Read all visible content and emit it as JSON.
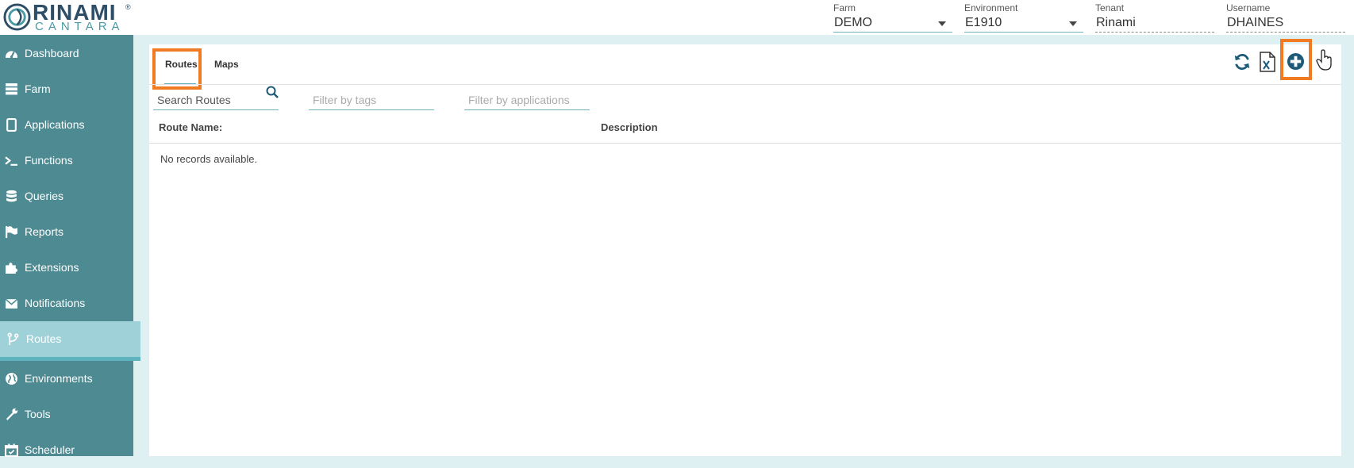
{
  "brand": {
    "name": "RINAMI",
    "sub": "CANTARA",
    "reg": "®"
  },
  "header": {
    "farm": {
      "label": "Farm",
      "value": "DEMO"
    },
    "environment": {
      "label": "Environment",
      "value": "E1910"
    },
    "tenant": {
      "label": "Tenant",
      "value": "Rinami"
    },
    "username": {
      "label": "Username",
      "value": "DHAINES"
    }
  },
  "sidebar": {
    "items": [
      {
        "label": "Dashboard",
        "icon": "dashboard-icon"
      },
      {
        "label": "Farm",
        "icon": "server-icon"
      },
      {
        "label": "Applications",
        "icon": "tablet-icon"
      },
      {
        "label": "Functions",
        "icon": "terminal-icon"
      },
      {
        "label": "Queries",
        "icon": "database-icon"
      },
      {
        "label": "Reports",
        "icon": "flag-icon"
      },
      {
        "label": "Extensions",
        "icon": "puzzle-icon"
      },
      {
        "label": "Notifications",
        "icon": "envelope-icon"
      },
      {
        "label": "Routes",
        "icon": "code-branch-icon",
        "active": true
      },
      {
        "label": "Environments",
        "icon": "globe-icon"
      },
      {
        "label": "Tools",
        "icon": "wrench-icon"
      },
      {
        "label": "Scheduler",
        "icon": "calendar-icon"
      }
    ]
  },
  "tabs": {
    "routes": "Routes",
    "maps": "Maps"
  },
  "toolbar": {
    "refresh": "refresh-icon",
    "excel": "excel-export-icon",
    "add": "add-circle-icon",
    "cursor": "hand-pointer-icon"
  },
  "filters": {
    "search": "Search Routes",
    "tags_placeholder": "Filter by tags",
    "apps_placeholder": "Filter by applications"
  },
  "table": {
    "columns": [
      "Route Name:",
      "Description"
    ],
    "empty": "No records available."
  },
  "colors": {
    "sidebar": "#4e8a92",
    "active_item": "#9fd2d8",
    "accent": "#5fb3be",
    "highlight": "#f07b22",
    "brand": "#2d4e66"
  }
}
